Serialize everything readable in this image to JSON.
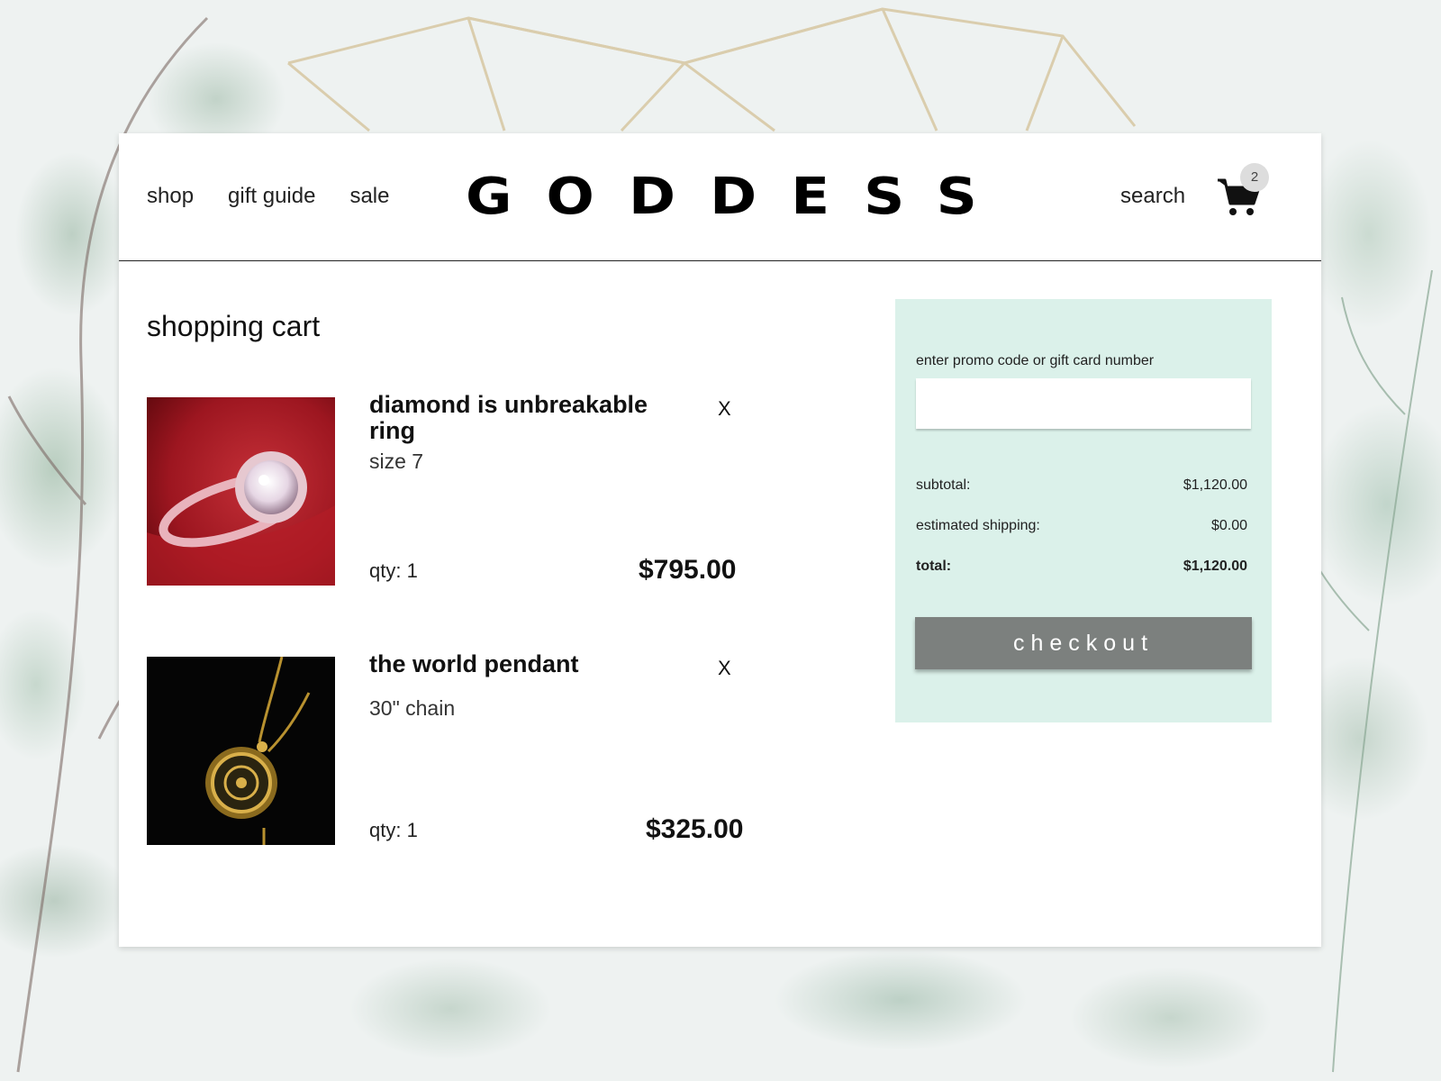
{
  "brand": {
    "logo": "GODDESS"
  },
  "nav": {
    "items": [
      "shop",
      "gift guide",
      "sale"
    ],
    "search_label": "search"
  },
  "cart": {
    "count": "2"
  },
  "page": {
    "title": "shopping cart"
  },
  "items": [
    {
      "name": "diamond is unbreakable ring",
      "variant": "size 7",
      "qty": "qty: 1",
      "price": "$795.00",
      "remove": "X"
    },
    {
      "name": "the world pendant",
      "variant": "30\" chain",
      "qty": "qty: 1",
      "price": "$325.00",
      "remove": "X"
    }
  ],
  "summary": {
    "promo_label": "enter promo code or gift card number",
    "promo_value": "",
    "subtotal_label": "subtotal:",
    "subtotal": "$1,120.00",
    "shipping_label": "estimated shipping:",
    "shipping": "$0.00",
    "total_label": "total:",
    "total": "$1,120.00",
    "checkout_label": "checkout"
  },
  "colors": {
    "summary_bg": "#dbf1ea",
    "checkout_bg": "#7c807e",
    "ring_bg": "#a3161d",
    "pendant_bg": "#050505"
  }
}
